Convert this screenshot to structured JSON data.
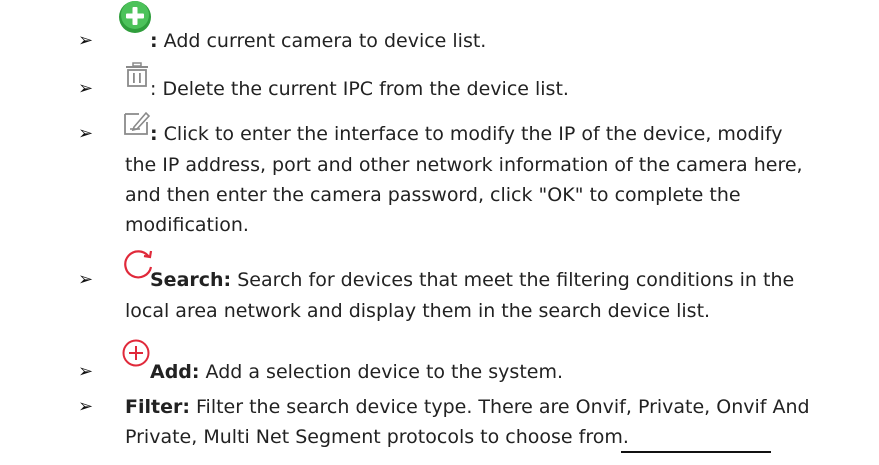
{
  "items": [
    {
      "icon": "add-circle-green-icon",
      "label": ":",
      "text": " Add current camera to device list."
    },
    {
      "icon": "trash-icon",
      "label": "",
      "text": ": Delete the current IPC from the device list."
    },
    {
      "icon": "edit-icon",
      "label": ":",
      "line1": " Click to enter the interface to modify the IP of the device, modify",
      "line2": "the IP address, port and other network information of the camera here,",
      "line3": "and then enter the camera password, click \"OK\" to complete the",
      "line4": "modification."
    },
    {
      "icon": "refresh-icon",
      "label": "Search:",
      "line1": " Search for devices that meet the filtering conditions in the",
      "line2": "local area network and display them in the search device list."
    },
    {
      "icon": "add-circle-red-icon",
      "label": "Add:",
      "text": " Add a selection device to the system."
    },
    {
      "label": "Filter:",
      "line1": " Filter the search device type. There are Onvif, Private, Onvif And",
      "line2": "Private, Multi Net Segment protocols to choose from."
    }
  ],
  "bullet": "➢",
  "colors": {
    "green": "#3cb44b",
    "red": "#e0293a",
    "gray": "#8a8a8a"
  }
}
